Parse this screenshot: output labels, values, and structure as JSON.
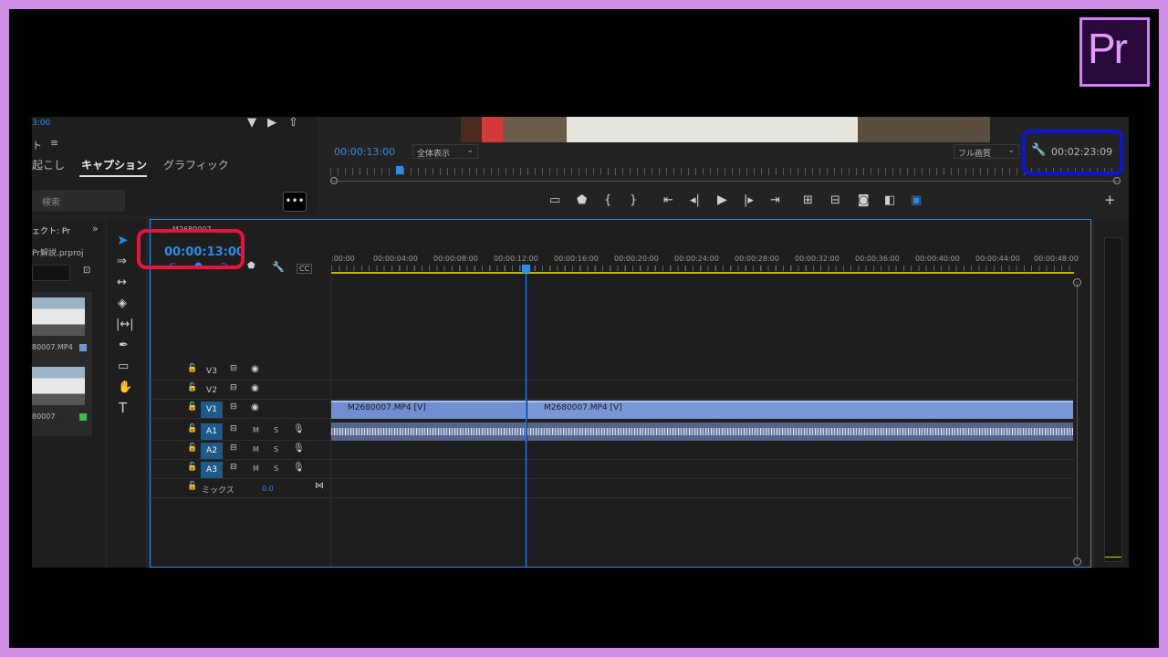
{
  "logo": {
    "text": "Pr"
  },
  "left_panel": {
    "timecode_partial": "3:00",
    "panel_title_partial": "ト",
    "tabs": [
      "起こし",
      "キャプション",
      "グラフィック"
    ],
    "search_placeholder": "検索",
    "project_tab_partial": "ェクト: Pr",
    "project_file": "Pr解説.prproj",
    "clips": [
      {
        "name": "80007.MP4",
        "color": "#6c97d4"
      },
      {
        "name": "80007",
        "color": "#3fba4a"
      }
    ]
  },
  "program_monitor": {
    "current_timecode": "00:00:13:00",
    "zoom_select": "全体表示",
    "quality_select": "フル画質",
    "duration_timecode": "00:02:23:09"
  },
  "timeline": {
    "sequence_name_partial": "M2680007",
    "timecode": "00:00:13:00",
    "ruler_labels": [
      ":00:00",
      "00:00:04:00",
      "00:00:08:00",
      "00:00:12:00",
      "00:00:16:00",
      "00:00:20:00",
      "00:00:24:00",
      "00:00:28:00",
      "00:00:32:00",
      "00:00:36:00",
      "00:00:40:00",
      "00:00:44:00",
      "00:00:48:00"
    ],
    "video_tracks": [
      "V3",
      "V2",
      "V1"
    ],
    "audio_tracks": [
      "A1",
      "A2",
      "A3"
    ],
    "mix_label": "ミックス",
    "mix_value": "0.0",
    "track_buttons": {
      "mute": "M",
      "solo": "S"
    },
    "clip_names": [
      "M2680007.MP4 [V]",
      "M2680007.MP4 [V]"
    ]
  },
  "colors": {
    "accent": "#2d8ceb",
    "highlight_red": "#e8143c",
    "highlight_blue": "#0a16d8",
    "brand": "#d97aff"
  }
}
